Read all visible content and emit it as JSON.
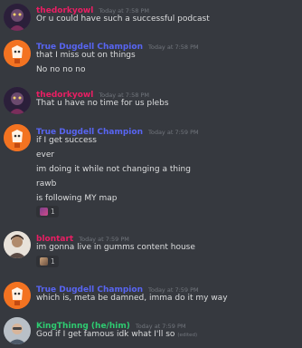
{
  "messages": [
    {
      "user": "thedorkyowl",
      "user_color": "#e91e63",
      "timestamp": "Today at 7:58 PM",
      "avatar_icon": "dark-character-avatar",
      "lines": [
        "Or u could have such a successful podcast"
      ]
    },
    {
      "user": "True Dugdell Champion",
      "user_color": "#5865f2",
      "timestamp": "Today at 7:58 PM",
      "avatar_icon": "orange-character-avatar",
      "lines": [
        "that I miss out on things",
        "No no no no"
      ]
    },
    {
      "user": "thedorkyowl",
      "user_color": "#e91e63",
      "timestamp": "Today at 7:58 PM",
      "avatar_icon": "dark-character-avatar",
      "lines": [
        "That u have no time for us plebs"
      ]
    },
    {
      "user": "True Dugdell Champion",
      "user_color": "#5865f2",
      "timestamp": "Today at 7:59 PM",
      "avatar_icon": "orange-character-avatar",
      "lines": [
        "if I get success",
        "ever",
        "im doing it while not changing a thing",
        "rawb",
        "is following MY map"
      ],
      "reaction": {
        "icon": "custom-emoji-icon",
        "count": "1"
      }
    },
    {
      "user": "blontart",
      "user_color": "#e91e63",
      "timestamp": "Today at 7:59 PM",
      "avatar_icon": "photo-avatar",
      "lines": [
        "im gonna live in gumms content house"
      ],
      "reaction": {
        "icon": "custom-emoji-icon",
        "count": "1"
      }
    },
    {
      "user": "True Dugdell Champion",
      "user_color": "#5865f2",
      "timestamp": "Today at 7:59 PM",
      "avatar_icon": "orange-character-avatar",
      "lines": [
        "which is, meta be damned, imma do it my way"
      ]
    },
    {
      "user": "KingThinng (he/him)",
      "user_color": "#2ecc71",
      "timestamp": "Today at 7:59 PM",
      "avatar_icon": "photo-avatar",
      "lines": [
        "God if I get famous idk what I'll so"
      ],
      "edited": "(edited)"
    }
  ]
}
